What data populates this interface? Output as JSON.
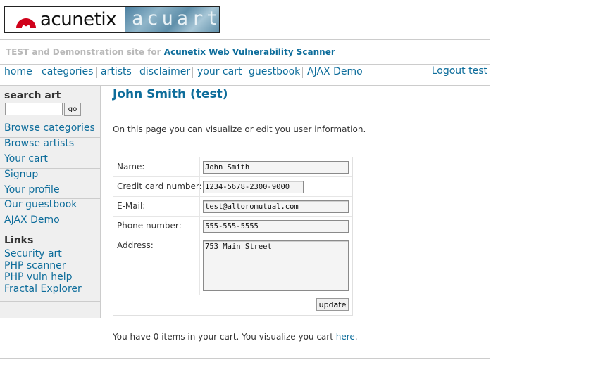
{
  "logo": {
    "left_word": "acunetix",
    "right_word": "acuart"
  },
  "tagline": {
    "prefix": "TEST and Demonstration site for",
    "product": "Acunetix Web Vulnerability Scanner"
  },
  "nav": {
    "items": [
      "home",
      "categories",
      "artists",
      "disclaimer",
      "your cart",
      "guestbook",
      "AJAX Demo"
    ],
    "logout": "Logout test"
  },
  "sidebar": {
    "search_label": "search art",
    "search_value": "",
    "go_label": "go",
    "menu": [
      "Browse categories",
      "Browse artists",
      "Your cart",
      "Signup",
      "Your profile",
      "Our guestbook",
      "AJAX Demo"
    ],
    "links_title": "Links",
    "links": [
      "Security art",
      "PHP scanner",
      "PHP vuln help",
      "Fractal Explorer"
    ]
  },
  "main": {
    "title": "John Smith (test)",
    "intro": "On this page you can visualize or edit you user information.",
    "form": {
      "name_label": "Name:",
      "name_value": "John Smith",
      "cc_label": "Credit card number:",
      "cc_value": "1234-5678-2300-9000",
      "email_label": "E-Mail:",
      "email_value": "test@altoromutual.com",
      "phone_label": "Phone number:",
      "phone_value": "555-555-5555",
      "address_label": "Address:",
      "address_value": "753 Main Street",
      "update_label": "update"
    },
    "cart_prefix": "You have 0 items in your cart. You visualize you cart",
    "cart_link": "here",
    "cart_suffix": "."
  },
  "colors": {
    "link": "#0e6d9b",
    "sidebar_bg": "#efefef",
    "logo_red": "#d0021b"
  }
}
